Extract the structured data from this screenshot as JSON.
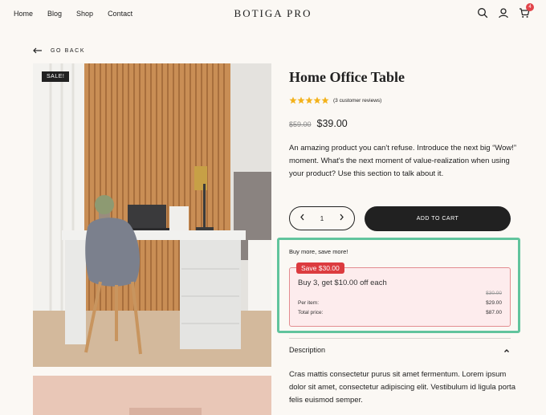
{
  "header": {
    "nav": [
      "Home",
      "Blog",
      "Shop",
      "Contact"
    ],
    "brand": "BOTIGA PRO",
    "cart_count": "4"
  },
  "go_back": "GO BACK",
  "gallery": {
    "sale_badge": "SALE!"
  },
  "product": {
    "title": "Home Office Table",
    "rating": 5,
    "reviews": "(3 customer reviews)",
    "old_price": "$59.00",
    "price": "$39.00",
    "description": "An amazing product you can't refuse. Introduce the next big “Wow!” moment. What's the next moment of value-realization when using your product? Use this section to talk about it.",
    "quantity": "1",
    "add_to_cart": "ADD TO CART"
  },
  "bundle": {
    "heading": "Buy more, save more!",
    "badge": "Save $30.00",
    "offer": "Buy 3, get $10.00 off each",
    "strike_price": "$30.00",
    "per_item_label": "Per item:",
    "per_item_value": "$29.00",
    "total_label": "Total price:",
    "total_value": "$87.00"
  },
  "accordion": {
    "title": "Description",
    "body": "Cras mattis consectetur purus sit amet fermentum. Lorem ipsum dolor sit amet, consectetur adipiscing elit. Vestibulum id ligula porta felis euismod semper."
  },
  "colors": {
    "background": "#fbf8f4",
    "dark": "#212121",
    "sale_red": "#dc3b3f",
    "highlight_green": "#61c49d",
    "star_gold": "#f3b21b"
  },
  "icons": [
    "search-icon",
    "user-icon",
    "cart-icon",
    "arrow-left-icon",
    "star-icon",
    "chevron-left-icon",
    "chevron-right-icon",
    "chevron-up-icon"
  ]
}
